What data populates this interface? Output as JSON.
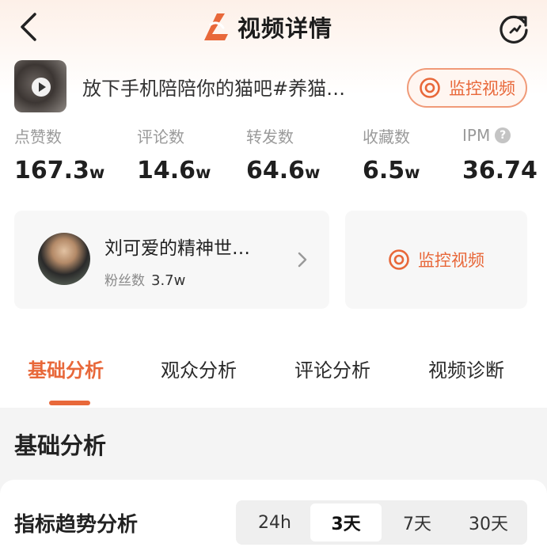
{
  "header": {
    "title": "视频详情"
  },
  "video": {
    "title": "放下手机陪陪你的猫吧#养猫…",
    "monitor_label": "监控视频"
  },
  "stats": [
    {
      "label": "点赞数",
      "value": "167.3",
      "unit": "w"
    },
    {
      "label": "评论数",
      "value": "14.6",
      "unit": "w"
    },
    {
      "label": "转发数",
      "value": "64.6",
      "unit": "w"
    },
    {
      "label": "收藏数",
      "value": "6.5",
      "unit": "w"
    },
    {
      "label": "IPM",
      "value": "36.74",
      "unit": ""
    }
  ],
  "help_glyph": "?",
  "author": {
    "name": "刘可爱的精神世…",
    "fans_label": "粉丝数",
    "fans_value": "3.7w",
    "monitor_label": "监控视频"
  },
  "tabs": [
    {
      "label": "基础分析",
      "active": true
    },
    {
      "label": "观众分析",
      "active": false
    },
    {
      "label": "评论分析",
      "active": false
    },
    {
      "label": "视频诊断",
      "active": false
    }
  ],
  "section": {
    "title": "基础分析"
  },
  "trend": {
    "title": "指标趋势分析",
    "ranges": [
      "24h",
      "3天",
      "7天",
      "30天"
    ],
    "selected": "3天"
  },
  "colors": {
    "accent": "#e8683a",
    "pill_border": "#f09a78"
  },
  "icons": {
    "back": "chevron-left-icon",
    "refresh": "refresh-icon",
    "logo": "app-logo-icon",
    "monitor": "target-icon",
    "chevron": "chevron-right-icon",
    "help": "help-icon",
    "play": "play-icon"
  }
}
